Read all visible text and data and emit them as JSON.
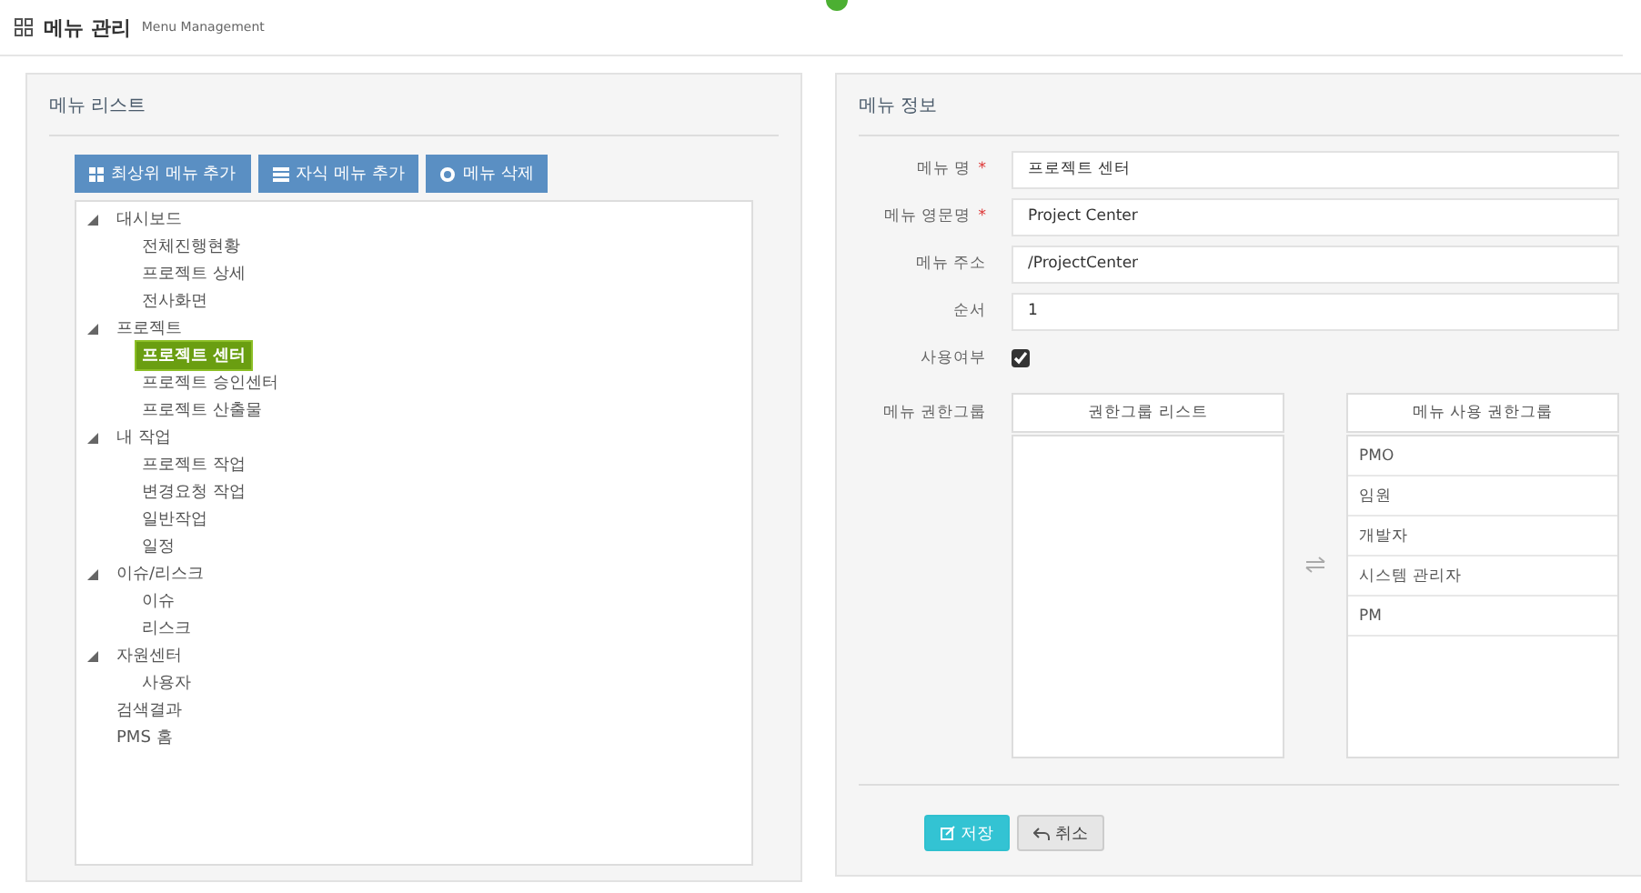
{
  "header": {
    "title": "메뉴 관리",
    "subtitle": "Menu Management"
  },
  "menu_list": {
    "title": "메뉴 리스트",
    "buttons": [
      {
        "label": "최상위 메뉴 추가",
        "kind": "grid"
      },
      {
        "label": "자식 메뉴 추가",
        "kind": "list"
      },
      {
        "label": "메뉴 삭제",
        "kind": "circle"
      }
    ],
    "tree": [
      {
        "label": "대시보드",
        "expanded": true,
        "selected": false,
        "children": [
          {
            "label": "전체진행현황",
            "selected": false
          },
          {
            "label": "프로젝트 상세",
            "selected": false
          },
          {
            "label": "전사화면",
            "selected": false
          }
        ]
      },
      {
        "label": "프로젝트",
        "expanded": true,
        "selected": false,
        "children": [
          {
            "label": "프로젝트 센터",
            "selected": true
          },
          {
            "label": "프로젝트 승인센터",
            "selected": false
          },
          {
            "label": "프로젝트 산출물",
            "selected": false
          }
        ]
      },
      {
        "label": "내 작업",
        "expanded": true,
        "selected": false,
        "children": [
          {
            "label": "프로젝트 작업",
            "selected": false
          },
          {
            "label": "변경요청 작업",
            "selected": false
          },
          {
            "label": "일반작업",
            "selected": false
          },
          {
            "label": "일정",
            "selected": false
          }
        ]
      },
      {
        "label": "이슈/리스크",
        "expanded": true,
        "selected": false,
        "children": [
          {
            "label": "이슈",
            "selected": false
          },
          {
            "label": "리스크",
            "selected": false
          }
        ]
      },
      {
        "label": "자원센터",
        "expanded": true,
        "selected": false,
        "children": [
          {
            "label": "사용자",
            "selected": false
          }
        ]
      },
      {
        "label": "검색결과",
        "selected": false
      },
      {
        "label": "PMS 홈",
        "selected": false
      }
    ]
  },
  "menu_info": {
    "title": "메뉴 정보",
    "fields": [
      {
        "label": "메뉴 명",
        "required_mark": "*",
        "kind": "text",
        "value": "프로젝트 센터"
      },
      {
        "label": "메뉴 영문명",
        "required_mark": "*",
        "kind": "text",
        "value": "Project Center"
      },
      {
        "label": "메뉴 주소",
        "kind": "text",
        "value": "/ProjectCenter"
      },
      {
        "label": "순서",
        "kind": "text",
        "value": "1"
      },
      {
        "label": "사용여부",
        "kind": "checkbox",
        "checked": true
      }
    ],
    "groups": {
      "label": "메뉴 권한그룹",
      "available_title": "권한그룹 리스트",
      "assigned_title": "메뉴 사용 권한그룹",
      "assigned": [
        "PMO",
        "임원",
        "개발자",
        "시스템 관리자",
        "PM"
      ]
    },
    "buttons": [
      {
        "label": "저장",
        "kind": "primary"
      },
      {
        "label": "취소",
        "kind": "default"
      }
    ]
  }
}
